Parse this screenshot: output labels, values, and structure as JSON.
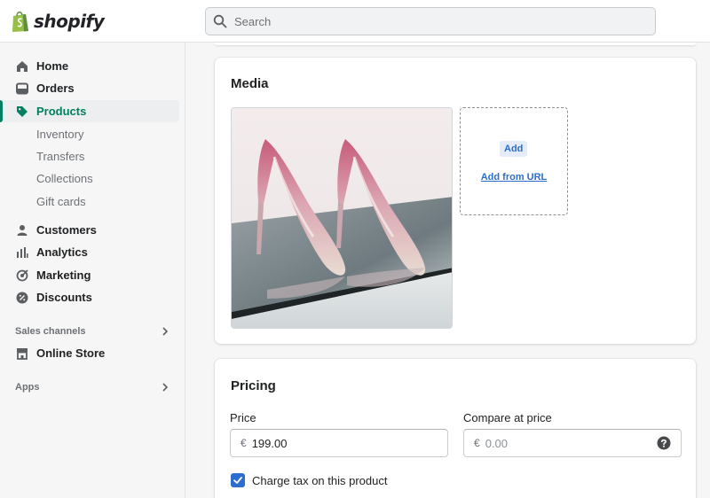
{
  "brand": {
    "name": "shopify",
    "color": "#95bf47"
  },
  "search": {
    "placeholder": "Search"
  },
  "sidebar": {
    "items": [
      {
        "label": "Home",
        "icon": "home-icon"
      },
      {
        "label": "Orders",
        "icon": "orders-icon"
      },
      {
        "label": "Products",
        "icon": "tag-icon",
        "active": true
      },
      {
        "label": "Customers",
        "icon": "person-icon"
      },
      {
        "label": "Analytics",
        "icon": "bar-chart-icon"
      },
      {
        "label": "Marketing",
        "icon": "target-icon"
      },
      {
        "label": "Discounts",
        "icon": "discount-icon"
      }
    ],
    "product_subitems": [
      "Inventory",
      "Transfers",
      "Collections",
      "Gift cards"
    ],
    "sales_channels_label": "Sales channels",
    "online_store": {
      "label": "Online Store",
      "icon": "store-icon"
    },
    "apps_label": "Apps",
    "active_color": "#008060"
  },
  "media": {
    "title": "Media",
    "image_alt": "Glitter pink high heels",
    "add_label": "Add",
    "add_from_url_label": "Add from URL"
  },
  "pricing": {
    "title": "Pricing",
    "price_label": "Price",
    "price_prefix": "€",
    "price_value": "199.00",
    "compare_label": "Compare at price",
    "compare_prefix": "€",
    "compare_placeholder": "0.00",
    "charge_tax_label": "Charge tax on this product",
    "charge_tax_checked": true
  }
}
